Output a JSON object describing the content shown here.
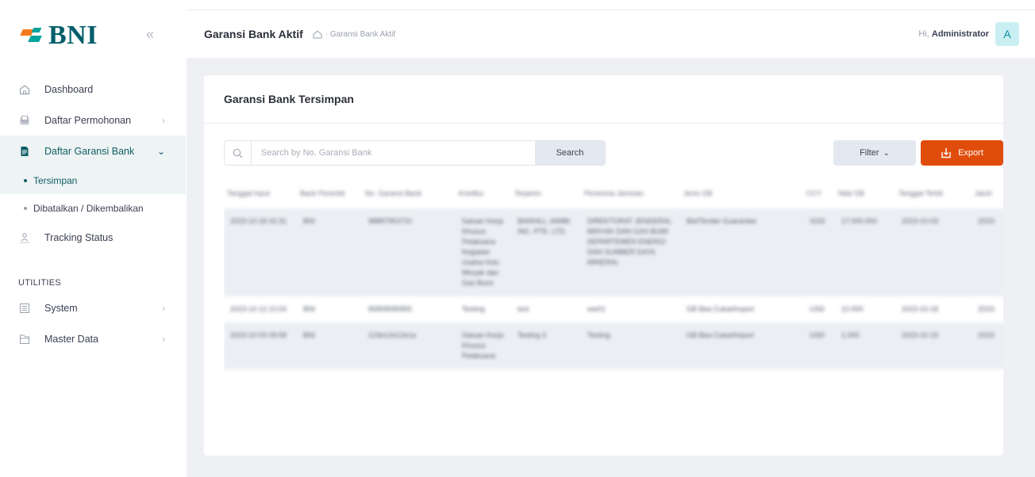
{
  "brand": {
    "logo_text": "BNI",
    "colors": {
      "primary": "#005e6a",
      "accent_orange": "#e04c0c",
      "accent_teal": "#00a39d"
    }
  },
  "sidebar": {
    "collapse_icon": "double-chevron-left-icon",
    "items": [
      {
        "label": "Dashboard",
        "icon": "home-icon"
      },
      {
        "label": "Daftar Permohonan",
        "icon": "inbox-icon"
      },
      {
        "label": "Daftar Garansi Bank",
        "icon": "document-icon"
      }
    ],
    "sub_items": [
      {
        "label": "Tersimpan"
      },
      {
        "label": "Dibatalkan / Dikembalikan"
      }
    ],
    "tracking": {
      "label": "Tracking Status",
      "icon": "users-icon"
    },
    "section_label": "UTILITIES",
    "utilities": [
      {
        "label": "System",
        "icon": "list-icon"
      },
      {
        "label": "Master Data",
        "icon": "folder-icon"
      }
    ]
  },
  "header": {
    "title": "Garansi Bank Aktif",
    "breadcrumb": "Garansi Bank Aktif",
    "greeting": "Hi,",
    "user": "Administrator",
    "avatar_initial": "A"
  },
  "card": {
    "title": "Garansi Bank Tersimpan",
    "search_placeholder": "Search by No. Garansi Bank",
    "search_button": "Search",
    "filter_button": "Filter",
    "export_button": "Export"
  },
  "table": {
    "headers": [
      "Tanggal Input",
      "Bank Penerbit",
      "No. Garansi Bank",
      "Kreditur",
      "Terjamin",
      "Penerima Jaminan",
      "Jenis GB",
      "CCY",
      "Nilai GB",
      "Tanggal Terbit",
      "Jatuh"
    ],
    "rows": [
      [
        "2023-10-18 02:31",
        "BNI",
        "98887953710",
        "Satuan Kerja Khusus Pelaksana Kegiatan Usaha Hulu Minyak dan Gas Bumi",
        "BANHILL JAMBI INC. PTE. LTD.",
        "DIREKTORAT JENDERAL MINYAK DAN GAS BUMI DEPARTEMEN ENERGI DAN SUMBER DAYA MINERAL",
        "Bid/Tender Guarantee",
        "SGD",
        "17.000.000",
        "2023-10-03",
        "2023-"
      ],
      [
        "2023-10-13 10:03",
        "BNI",
        "85858585855",
        "Testing",
        "test",
        "ww01",
        "GB Bea Cukai/Import",
        "USD",
        "10.000",
        "2023-10-18",
        "2023-"
      ],
      [
        "2023-10-03 09:58",
        "BNI",
        "123e12e12e1a",
        "Satuan Kerja Khusus Pelaksana",
        "Testing 3",
        "Testing",
        "GB Bea Cukai/Import",
        "USD",
        "1.000",
        "2023-10-19",
        "2023-"
      ]
    ]
  }
}
